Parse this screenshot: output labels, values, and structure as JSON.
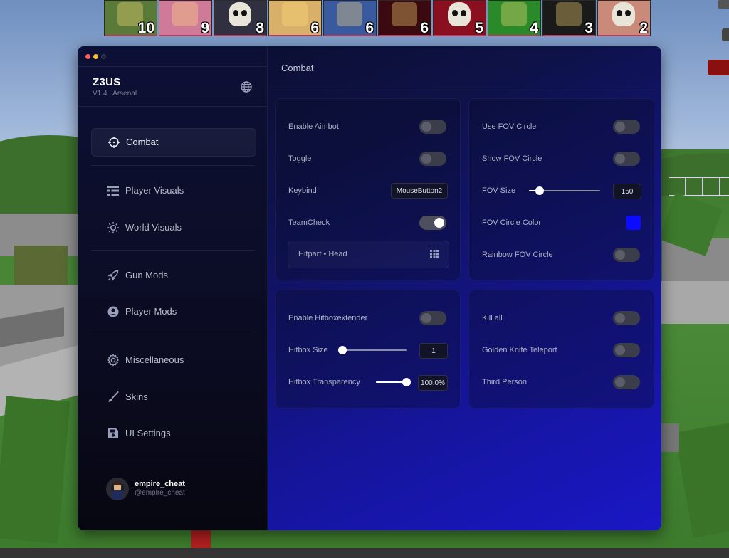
{
  "scoreboard": [
    {
      "kills": "10",
      "avatar": "zombie-avatar",
      "color": "#5a7a3a"
    },
    {
      "kills": "9",
      "avatar": "woman-avatar",
      "color": "#d07a9a"
    },
    {
      "kills": "8",
      "avatar": "skull-avatar",
      "color": "#303040"
    },
    {
      "kills": "6",
      "avatar": "blonde-avatar",
      "color": "#d9b06a"
    },
    {
      "kills": "6",
      "avatar": "yellow-avatar",
      "color": "#3a5aa0"
    },
    {
      "kills": "6",
      "avatar": "dark-avatar",
      "color": "#3a0a10"
    },
    {
      "kills": "5",
      "avatar": "skeleton-avatar",
      "color": "#8a1020"
    },
    {
      "kills": "4",
      "avatar": "green-spiky-avatar",
      "color": "#2a8a2a"
    },
    {
      "kills": "3",
      "avatar": "helmet-avatar",
      "color": "#1a1a1a"
    },
    {
      "kills": "2",
      "avatar": "skull-avatar-2",
      "color": "#c98a7a"
    }
  ],
  "brand": {
    "title": "Z3US",
    "subtitle": "V1.4 | Arsenal"
  },
  "nav": [
    {
      "label": "Combat",
      "icon": "crosshair-icon",
      "active": true
    },
    {
      "label": "Player Visuals",
      "icon": "list-icon"
    },
    {
      "label": "World Visuals",
      "icon": "sun-icon"
    },
    {
      "label": "Gun Mods",
      "icon": "rocket-icon"
    },
    {
      "label": "Player Mods",
      "icon": "user-icon"
    },
    {
      "label": "Miscellaneous",
      "icon": "gear-icon"
    },
    {
      "label": "Skins",
      "icon": "brush-icon"
    },
    {
      "label": "UI Settings",
      "icon": "save-icon"
    }
  ],
  "user": {
    "name": "empire_cheat",
    "handle": "@empire_cheat"
  },
  "header": {
    "title": "Combat"
  },
  "aimbot": {
    "enable_label": "Enable Aimbot",
    "enable_on": false,
    "toggle_label": "Toggle",
    "toggle_on": false,
    "keybind_label": "Keybind",
    "keybind_value": "MouseButton2",
    "teamcheck_label": "TeamCheck",
    "teamcheck_on": true,
    "hitpart_label": "Hitpart • Head"
  },
  "fov": {
    "use_label": "Use FOV Circle",
    "use_on": false,
    "show_label": "Show FOV Circle",
    "show_on": false,
    "size_label": "FOV Size",
    "size_value": "150",
    "size_fraction": 0.15,
    "color_label": "FOV Circle Color",
    "color": "#0b0bff",
    "rainbow_label": "Rainbow FOV Circle",
    "rainbow_on": false
  },
  "hitbox": {
    "enable_label": "Enable Hitboxextender",
    "enable_on": false,
    "size_label": "Hitbox Size",
    "size_value": "1",
    "size_fraction": 0.0,
    "transparency_label": "Hitbox Transparency",
    "transparency_value": "100.0%",
    "transparency_fraction": 1.0
  },
  "misc": {
    "killall_label": "Kill all",
    "killall_on": false,
    "knife_label": "Golden Knife Teleport",
    "knife_on": false,
    "thirdperson_label": "Third Person",
    "thirdperson_on": false
  },
  "colors": {
    "window_accent": "#1a17c6",
    "traffic_red": "#ff5f57",
    "traffic_yellow": "#febc2e",
    "traffic_off": "#2a2d3a"
  }
}
